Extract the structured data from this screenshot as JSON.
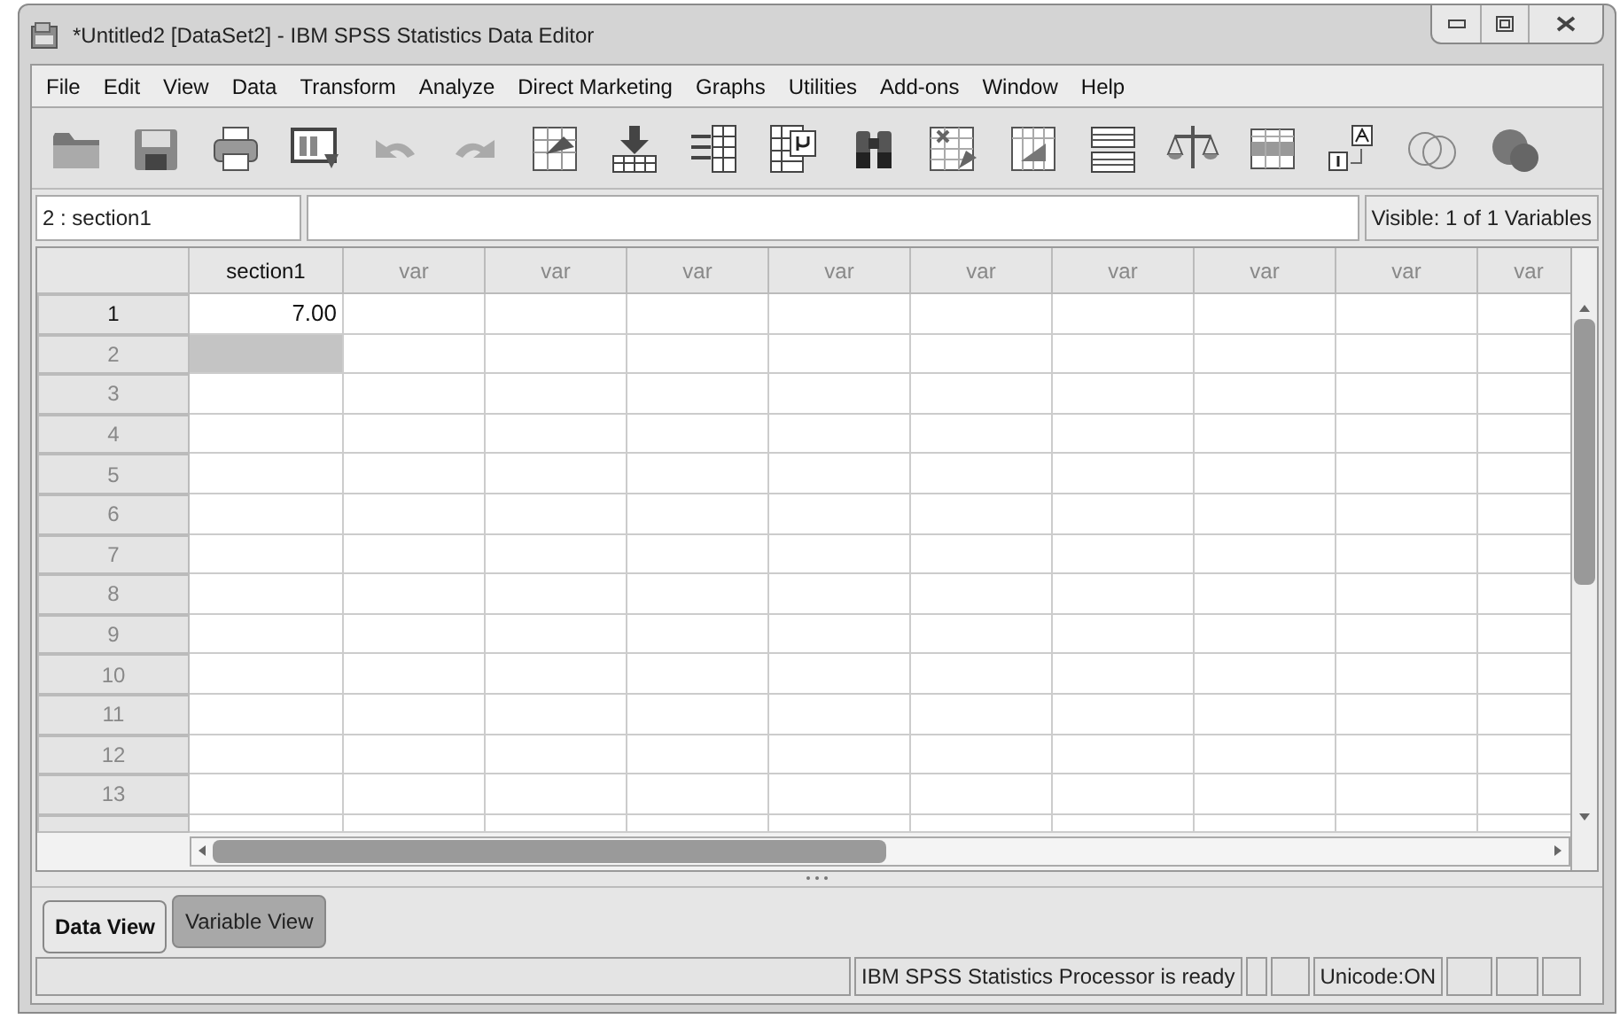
{
  "window": {
    "title": "*Untitled2 [DataSet2] - IBM SPSS Statistics Data Editor"
  },
  "menu": [
    {
      "label": "File"
    },
    {
      "label": "Edit"
    },
    {
      "label": "View"
    },
    {
      "label": "Data"
    },
    {
      "label": "Transform"
    },
    {
      "label": "Analyze"
    },
    {
      "label": "Direct Marketing"
    },
    {
      "label": "Graphs"
    },
    {
      "label": "Utilities"
    },
    {
      "label": "Add-ons"
    },
    {
      "label": "Window"
    },
    {
      "label": "Help"
    }
  ],
  "cell_editor": {
    "location": "2 : section1",
    "visible": "Visible: 1 of 1 Variables"
  },
  "grid": {
    "columns": [
      {
        "label": "section1",
        "defined": true
      },
      {
        "label": "var",
        "defined": false
      },
      {
        "label": "var",
        "defined": false
      },
      {
        "label": "var",
        "defined": false
      },
      {
        "label": "var",
        "defined": false
      },
      {
        "label": "var",
        "defined": false
      },
      {
        "label": "var",
        "defined": false
      },
      {
        "label": "var",
        "defined": false
      },
      {
        "label": "var",
        "defined": false
      },
      {
        "label": "var",
        "defined": false
      }
    ],
    "rows": [
      {
        "label": "1",
        "has_data": true,
        "cells": [
          "7.00"
        ],
        "selected": false
      },
      {
        "label": "2",
        "has_data": false,
        "cells": [],
        "selected": true
      },
      {
        "label": "3",
        "has_data": false,
        "cells": [],
        "selected": false
      },
      {
        "label": "4",
        "has_data": false,
        "cells": [],
        "selected": false
      },
      {
        "label": "5",
        "has_data": false,
        "cells": [],
        "selected": false
      },
      {
        "label": "6",
        "has_data": false,
        "cells": [],
        "selected": false
      },
      {
        "label": "7",
        "has_data": false,
        "cells": [],
        "selected": false
      },
      {
        "label": "8",
        "has_data": false,
        "cells": [],
        "selected": false
      },
      {
        "label": "9",
        "has_data": false,
        "cells": [],
        "selected": false
      },
      {
        "label": "10",
        "has_data": false,
        "cells": [],
        "selected": false
      },
      {
        "label": "11",
        "has_data": false,
        "cells": [],
        "selected": false
      },
      {
        "label": "12",
        "has_data": false,
        "cells": [],
        "selected": false
      },
      {
        "label": "13",
        "has_data": false,
        "cells": [],
        "selected": false
      }
    ]
  },
  "tabs": [
    {
      "label": "Data View",
      "selected": true
    },
    {
      "label": "Variable View",
      "selected": false
    }
  ],
  "status_bar": {
    "message": "IBM SPSS Statistics Processor is ready",
    "encoding": "Unicode:ON"
  }
}
